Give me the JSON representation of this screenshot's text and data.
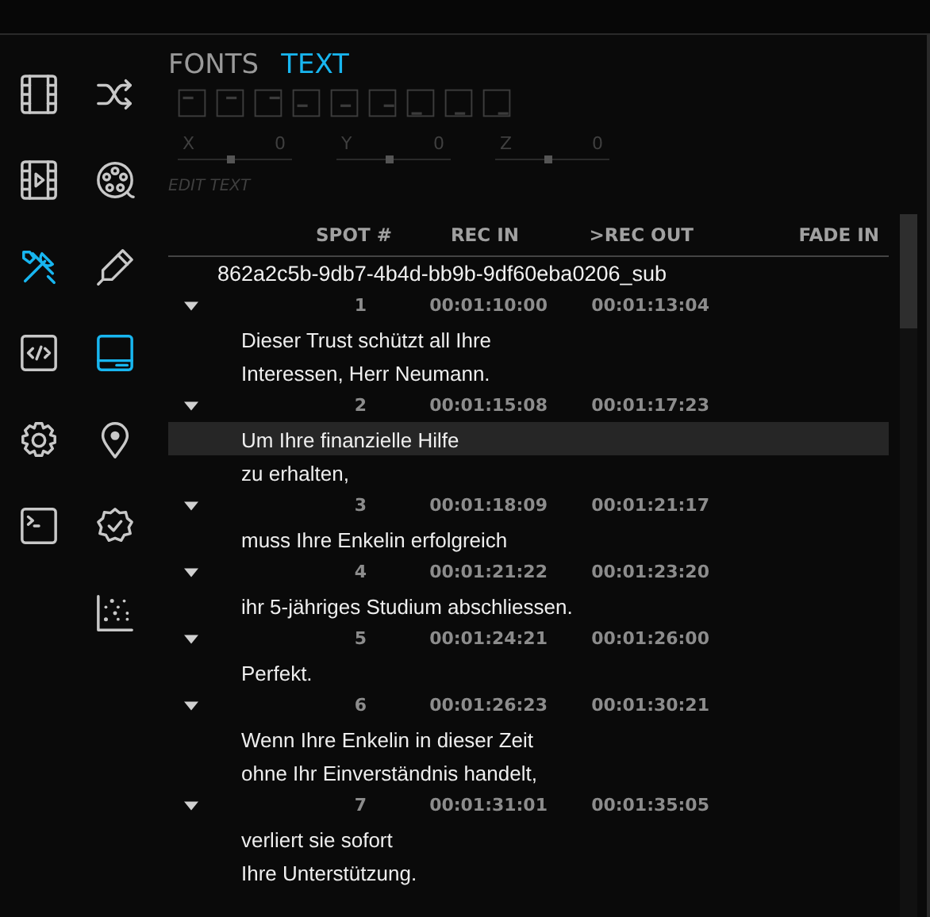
{
  "sidebar": {
    "icons": [
      {
        "kind": "film",
        "selected": false
      },
      {
        "kind": "shuffle",
        "selected": false
      },
      {
        "kind": "video",
        "selected": false
      },
      {
        "kind": "reel",
        "selected": false
      },
      {
        "kind": "tools",
        "selected": true
      },
      {
        "kind": "pen",
        "selected": false
      },
      {
        "kind": "code",
        "selected": false
      },
      {
        "kind": "panel",
        "selected": true
      },
      {
        "kind": "gear",
        "selected": false
      },
      {
        "kind": "pin",
        "selected": false
      },
      {
        "kind": "terminal",
        "selected": false
      },
      {
        "kind": "badge",
        "selected": false
      },
      {
        "kind": "scatter",
        "selected": false
      }
    ]
  },
  "tabs": [
    {
      "label": "FONTS",
      "selected": false
    },
    {
      "label": "TEXT",
      "selected": true
    }
  ],
  "align_buttons": [
    {
      "kind": "top-left",
      "disabled": true
    },
    {
      "kind": "top-center",
      "disabled": true
    },
    {
      "kind": "top-right",
      "disabled": true
    },
    {
      "kind": "mid-left",
      "disabled": true
    },
    {
      "kind": "mid-center",
      "disabled": true
    },
    {
      "kind": "mid-right",
      "disabled": true
    },
    {
      "kind": "bottom-left",
      "disabled": true
    },
    {
      "kind": "bottom-center",
      "disabled": true
    },
    {
      "kind": "bottom-right",
      "disabled": true
    }
  ],
  "position_sliders": [
    {
      "label": "X",
      "value": "0",
      "level": 0.47
    },
    {
      "label": "Y",
      "value": "0",
      "level": 0.47
    },
    {
      "label": "Z",
      "value": "0",
      "level": 0.47
    }
  ],
  "edit_text_label": "EDIT TEXT",
  "table": {
    "columns": [
      "SPOT #",
      "REC IN",
      ">REC OUT",
      "FADE IN"
    ],
    "group_title": "862a2c5b-9db7-4b4d-bb9b-9df60eba0206_sub",
    "rows": [
      {
        "spot": "1",
        "rec_in": "00:01:10:00",
        "rec_out": "00:01:13:04",
        "expanded": true,
        "lines": [
          {
            "text": "Dieser Trust schützt all Ihre",
            "selected": false
          },
          {
            "text": "Interessen, Herr Neumann.",
            "selected": false
          }
        ]
      },
      {
        "spot": "2",
        "rec_in": "00:01:15:08",
        "rec_out": "00:01:17:23",
        "expanded": true,
        "lines": [
          {
            "text": "Um Ihre finanzielle Hilfe",
            "selected": true
          },
          {
            "text": "zu erhalten,",
            "selected": false
          }
        ]
      },
      {
        "spot": "3",
        "rec_in": "00:01:18:09",
        "rec_out": "00:01:21:17",
        "expanded": true,
        "lines": [
          {
            "text": "muss Ihre Enkelin erfolgreich",
            "selected": false
          }
        ]
      },
      {
        "spot": "4",
        "rec_in": "00:01:21:22",
        "rec_out": "00:01:23:20",
        "expanded": true,
        "lines": [
          {
            "text": "ihr 5-jähriges Studium abschliessen.",
            "selected": false
          }
        ]
      },
      {
        "spot": "5",
        "rec_in": "00:01:24:21",
        "rec_out": "00:01:26:00",
        "expanded": true,
        "lines": [
          {
            "text": "Perfekt.",
            "selected": false
          }
        ]
      },
      {
        "spot": "6",
        "rec_in": "00:01:26:23",
        "rec_out": "00:01:30:21",
        "expanded": true,
        "lines": [
          {
            "text": "Wenn Ihre Enkelin in dieser Zeit",
            "selected": false
          },
          {
            "text": "ohne Ihr Einverständnis handelt,",
            "selected": false
          }
        ]
      },
      {
        "spot": "7",
        "rec_in": "00:01:31:01",
        "rec_out": "00:01:35:05",
        "expanded": true,
        "lines": [
          {
            "text": "verliert sie sofort",
            "selected": false
          },
          {
            "text": "Ihre Unterstützung.",
            "selected": false
          }
        ]
      }
    ]
  }
}
